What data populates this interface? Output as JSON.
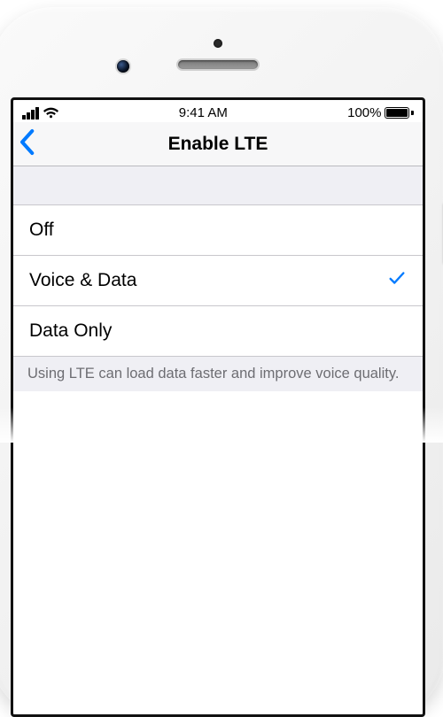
{
  "status": {
    "time": "9:41 AM",
    "battery_pct": "100%"
  },
  "nav": {
    "title": "Enable LTE"
  },
  "options": [
    {
      "label": "Off",
      "selected": false
    },
    {
      "label": "Voice & Data",
      "selected": true
    },
    {
      "label": "Data Only",
      "selected": false
    }
  ],
  "footer": "Using LTE can load data faster and improve voice quality.",
  "icons": {
    "back": "chevron-left-icon",
    "wifi": "wifi-icon",
    "signal": "cell-signal-icon",
    "battery": "battery-icon",
    "check": "checkmark-icon"
  },
  "colors": {
    "tint": "#007aff",
    "separator": "#c8c7cc",
    "groupbg": "#efeff4"
  }
}
